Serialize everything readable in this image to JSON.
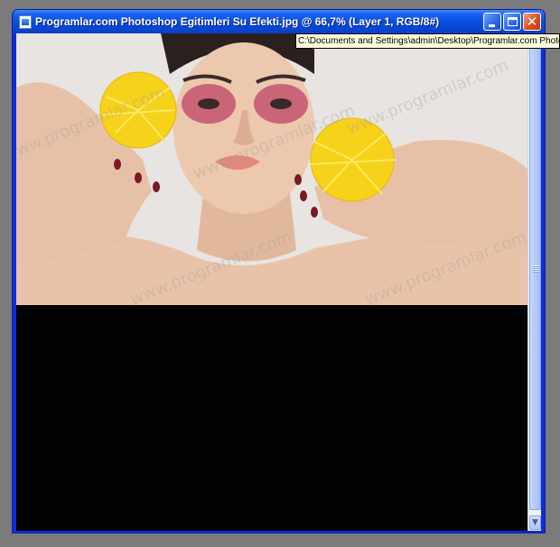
{
  "window": {
    "title": "Programlar.com Photoshop Egitimleri Su Efekti.jpg @ 66,7% (Layer 1, RGB/8#)"
  },
  "tooltip": {
    "text": "C:\\Documents and Settings\\admin\\Desktop\\Programlar.com Photoshop Egitimleri Su Efekti.jpg"
  },
  "canvas": {
    "watermark": "www.programlar.com",
    "watermark_color": "#a0a0a0",
    "lower_color": "#020202"
  },
  "colors": {
    "titlebar": "#0a4fe2",
    "close_button": "#de4a1c",
    "tooltip_bg": "#ffffe1"
  }
}
